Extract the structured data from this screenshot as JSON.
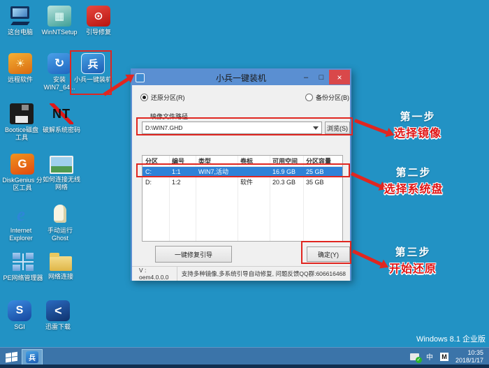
{
  "desktop": {
    "os_label": "Windows 8.1 企业版",
    "icons": [
      {
        "name": "this-pc",
        "label": "这台电脑",
        "glyph": ""
      },
      {
        "name": "winntsetup",
        "label": "WinNTSetup",
        "glyph": "▦"
      },
      {
        "name": "boot-repair",
        "label": "引导修复",
        "glyph": "⊙"
      },
      {
        "name": "remote-software",
        "label": "远程软件",
        "glyph": "☀"
      },
      {
        "name": "install-win7",
        "label": "安装 WIN7_64...",
        "glyph": "↻"
      },
      {
        "name": "xiaobing-installer",
        "label": "小兵一键装机",
        "glyph": "兵"
      },
      {
        "name": "bootice",
        "label": "Bootice磁盘 工具",
        "glyph": ""
      },
      {
        "name": "password-crack",
        "label": "破解系统密码",
        "glyph": "NT"
      },
      {
        "name": "diskgenius",
        "label": "DiskGenius 分区工具",
        "glyph": "G"
      },
      {
        "name": "wireless-help",
        "label": "如何连接无线 网络",
        "glyph": ""
      },
      {
        "name": "internet-explorer",
        "label": "Internet Explorer",
        "glyph": "e"
      },
      {
        "name": "ghost",
        "label": "手动运行 Ghost",
        "glyph": ""
      },
      {
        "name": "pe-network-manager",
        "label": "PE网络管理器",
        "glyph": ""
      },
      {
        "name": "network-connect",
        "label": "网络连接",
        "glyph": ""
      },
      {
        "name": "sgi",
        "label": "SGI",
        "glyph": "S"
      },
      {
        "name": "thunder-download",
        "label": "迅雷下载",
        "glyph": "<"
      }
    ]
  },
  "dialog": {
    "title": "小兵一键装机",
    "controls": {
      "minimize": "–",
      "maximize": "□",
      "close": "×"
    },
    "radio_restore_label": "还原分区(R)",
    "radio_backup_label": "备份分区(B)",
    "path_label": "映像文件路径",
    "path_value": "D:\\WIN7.GHD",
    "browse_label": "浏览(S)",
    "table": {
      "headers": [
        "分区",
        "编号",
        "类型",
        "卷标",
        "可用空间",
        "分区容量"
      ],
      "rows": [
        [
          "C:",
          "1:1",
          "WIN7,活动",
          "",
          "16.9 GB",
          "25 GB"
        ],
        [
          "D:",
          "1:2",
          "",
          "软件",
          "20.3 GB",
          "35 GB"
        ]
      ]
    },
    "repair_label": "一键修复引导",
    "ok_label": "确定(Y)",
    "version": "V : oem4.0.0.0",
    "status": "支持多种镜像,多系统引导自动修复, 问题反馈QQ群:606616468"
  },
  "annotations": {
    "step1": {
      "title": "第一步",
      "sub": "选择镜像"
    },
    "step2": {
      "title": "第二步",
      "sub": "选择系统盘"
    },
    "step3": {
      "title": "第三步",
      "sub": "开始还原"
    }
  },
  "taskbar": {
    "ime_cn": "中",
    "ime_m": "M",
    "time": "10:35",
    "date": "2018/1/17"
  },
  "colors": {
    "desktop_bg": "#2292c4",
    "taskbar_bg": "#3b74a9",
    "dialog_titlebar": "#5a8fd2",
    "annotation_red": "#e02620",
    "selection_blue": "#2e82d8",
    "close_red": "#d9484a"
  }
}
